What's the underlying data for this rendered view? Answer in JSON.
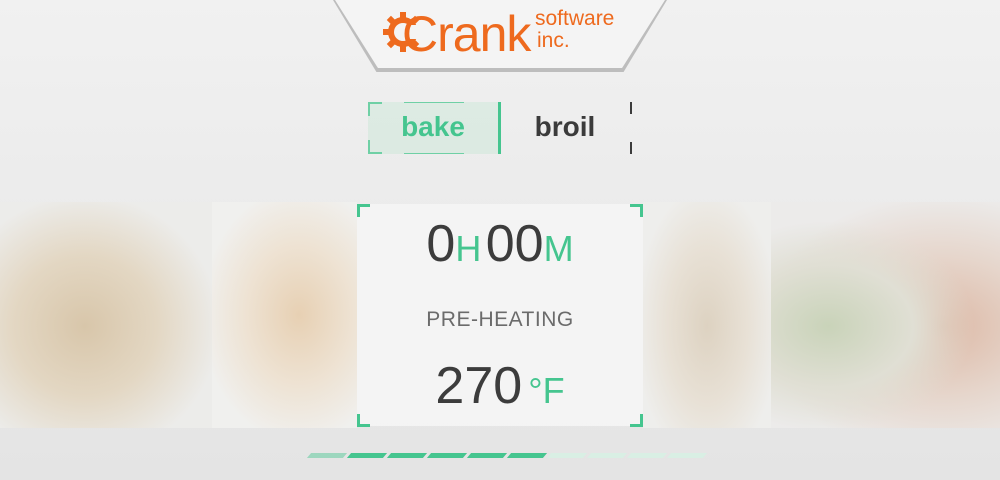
{
  "brand": {
    "name": "Crank",
    "sub_line1": "software",
    "sub_line2": "inc.",
    "color": "#ee6a1e"
  },
  "modes": {
    "items": [
      {
        "label": "bake",
        "selected": true
      },
      {
        "label": "broil",
        "selected": false
      }
    ],
    "accent": "#45c58f"
  },
  "timer": {
    "hours": "0",
    "hours_unit": "H",
    "minutes": "00",
    "minutes_unit": "M"
  },
  "status": "PRE-HEATING",
  "temperature": {
    "value": "270",
    "unit": "°F"
  },
  "progress": {
    "filled_segments": 6,
    "total_segments": 10
  }
}
